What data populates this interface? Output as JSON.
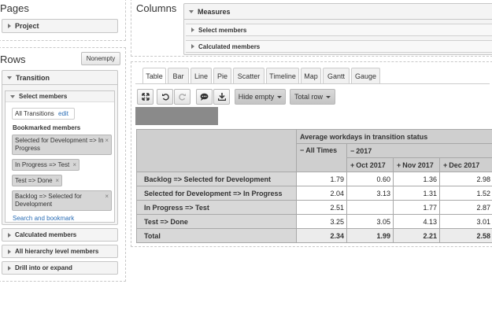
{
  "left": {
    "pages_title": "Pages",
    "project": "Project",
    "rows_title": "Rows",
    "nonempty": "Nonempty",
    "transition": "Transition",
    "select_members": "Select members",
    "all_transitions": "All Transitions",
    "edit": "edit",
    "bookmarked": "Bookmarked members",
    "chips": [
      "Selected for Development => In Progress",
      "In Progress => Test",
      "Test => Done",
      "Backlog => Selected for Development"
    ],
    "chip_remove": "×",
    "search_bookmark": "Search and bookmark",
    "calculated": "Calculated members",
    "all_hierarchy": "All hierarchy level members",
    "drill": "Drill into or expand"
  },
  "columns": {
    "title": "Columns",
    "measures": "Measures",
    "select_members": "Select members",
    "calculated": "Calculated members"
  },
  "tabs": [
    "Table",
    "Bar",
    "Line",
    "Pie",
    "Scatter",
    "Timeline",
    "Map",
    "Gantt",
    "Gauge"
  ],
  "toolbar": {
    "hide_empty": "Hide empty",
    "total_row": "Total row"
  },
  "table": {
    "measure": "Average workdays in transition status",
    "all_times": "All Times",
    "year": "2017",
    "months": [
      "Oct 2017",
      "Nov 2017",
      "Dec 2017"
    ],
    "minus": "−",
    "plus": "+",
    "rows": [
      {
        "label": "Backlog => Selected for Development",
        "values": [
          "1.79",
          "0.60",
          "1.36",
          "2.98"
        ]
      },
      {
        "label": "Selected for Development => In Progress",
        "values": [
          "2.04",
          "3.13",
          "1.31",
          "1.52"
        ]
      },
      {
        "label": "In Progress => Test",
        "values": [
          "2.51",
          "",
          "1.77",
          "2.87"
        ]
      },
      {
        "label": "Test => Done",
        "values": [
          "3.25",
          "3.05",
          "4.13",
          "3.01"
        ]
      }
    ],
    "total": {
      "label": "Total",
      "values": [
        "2.34",
        "1.99",
        "2.21",
        "2.58"
      ]
    }
  }
}
